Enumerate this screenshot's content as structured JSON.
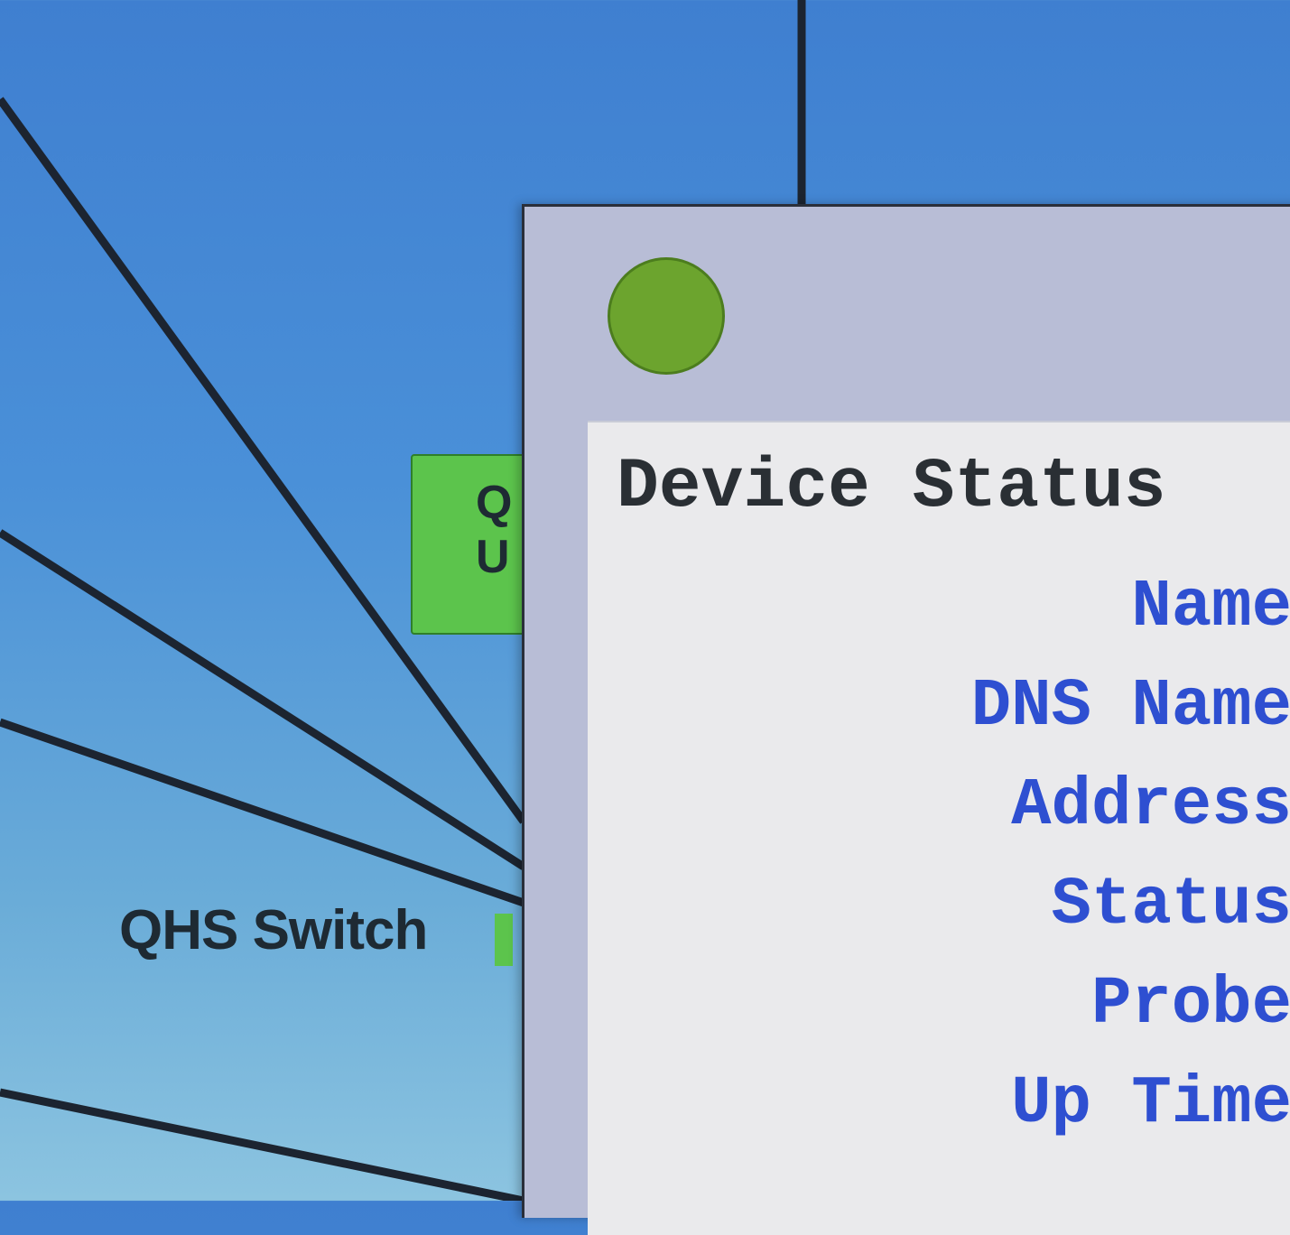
{
  "network_map": {
    "switch_node": {
      "line1": "Q",
      "line2": "U",
      "status_color": "#5cc44c"
    },
    "switch_caption": "QHS Switch"
  },
  "device_window": {
    "status_led_color": "#6ca42e",
    "title": "Device Status",
    "fields": [
      {
        "label": "Name"
      },
      {
        "label": "DNS Name"
      },
      {
        "label": "Address"
      },
      {
        "label": "Status"
      },
      {
        "label": "Probe"
      },
      {
        "label": "Up Time"
      }
    ]
  }
}
